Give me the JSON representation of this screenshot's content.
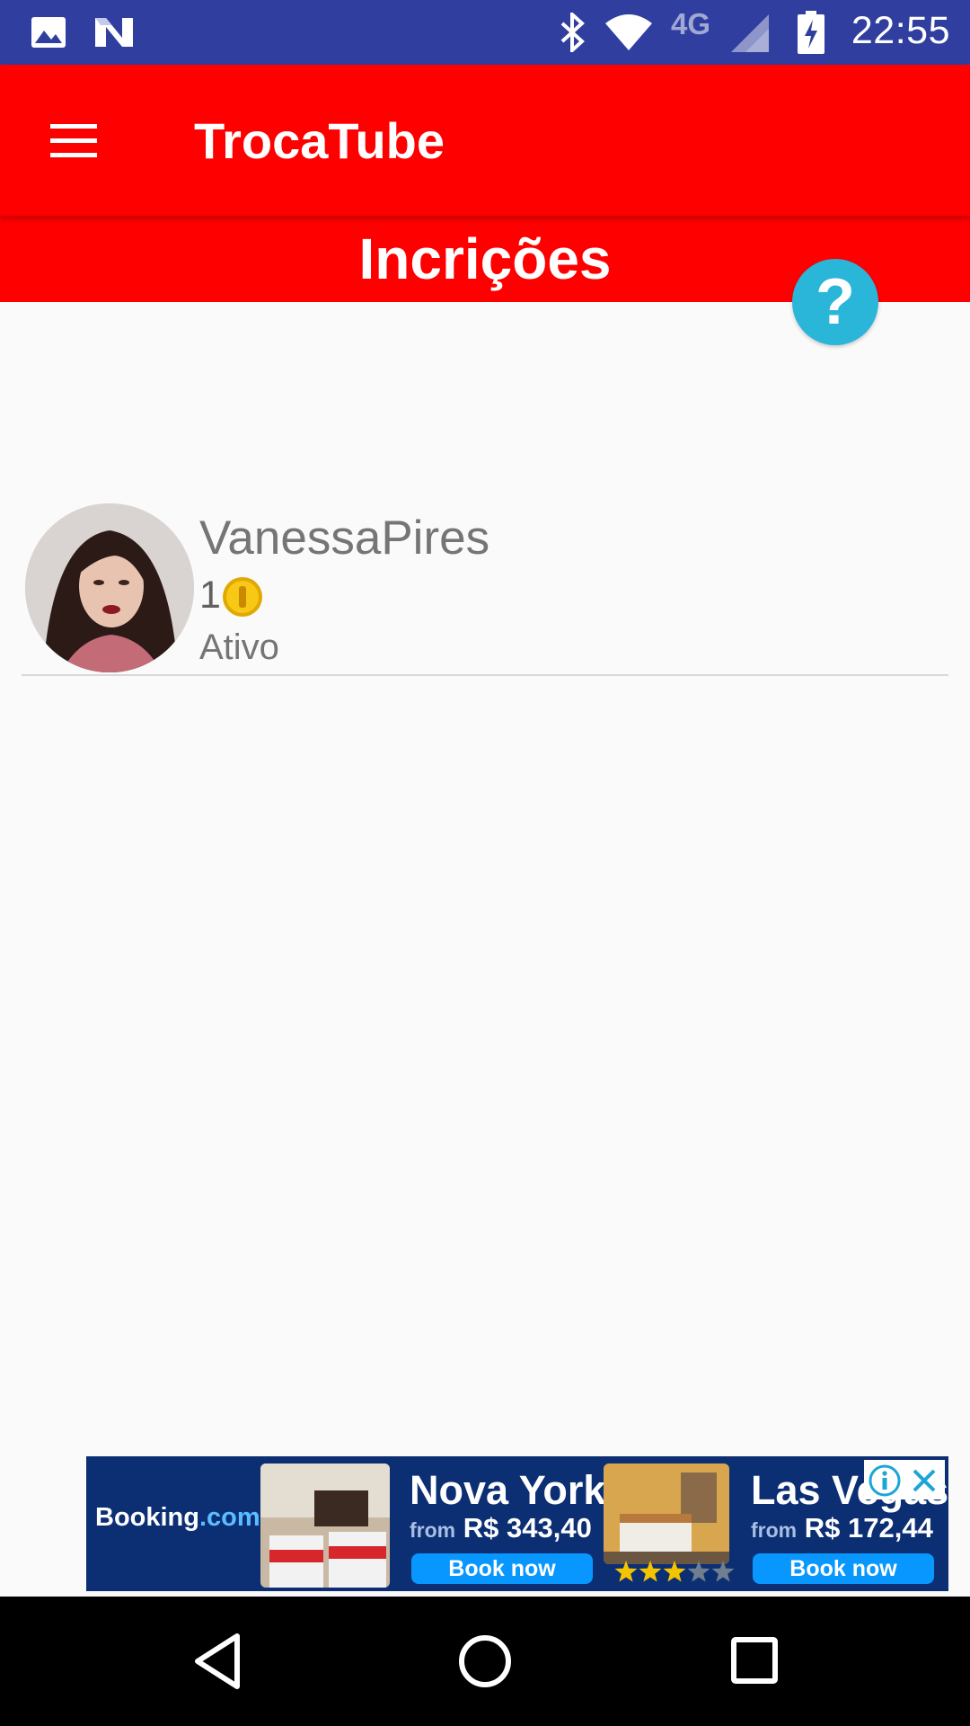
{
  "status_bar": {
    "time": "22:55",
    "network_label": "4G",
    "icons": [
      "image-icon",
      "n-icon",
      "bluetooth-icon",
      "wifi-icon",
      "signal-icon",
      "battery-icon"
    ]
  },
  "app_bar": {
    "title": "TrocaTube",
    "menu_icon": "hamburger-menu-icon"
  },
  "section": {
    "title": "Incrições",
    "help_label": "?"
  },
  "subscriptions": [
    {
      "name": "VanessaPires",
      "coins": "1",
      "status": "Ativo"
    }
  ],
  "ad": {
    "brand_prefix": "Booking",
    "brand_suffix": ".com",
    "offers": [
      {
        "city": "Nova York",
        "from": "from",
        "price": "R$ 343,40",
        "cta": "Book now"
      },
      {
        "city": "Las Vegas",
        "from": "from",
        "price": "R$ 172,44",
        "cta": "Book now"
      }
    ],
    "rating_stars": 3,
    "rating_max": 5
  },
  "colors": {
    "status_bar": "#303f9f",
    "primary": "#ff0000",
    "help_button": "#29b6d8",
    "ad_background": "#0c2f74",
    "ad_button": "#0896ff"
  }
}
